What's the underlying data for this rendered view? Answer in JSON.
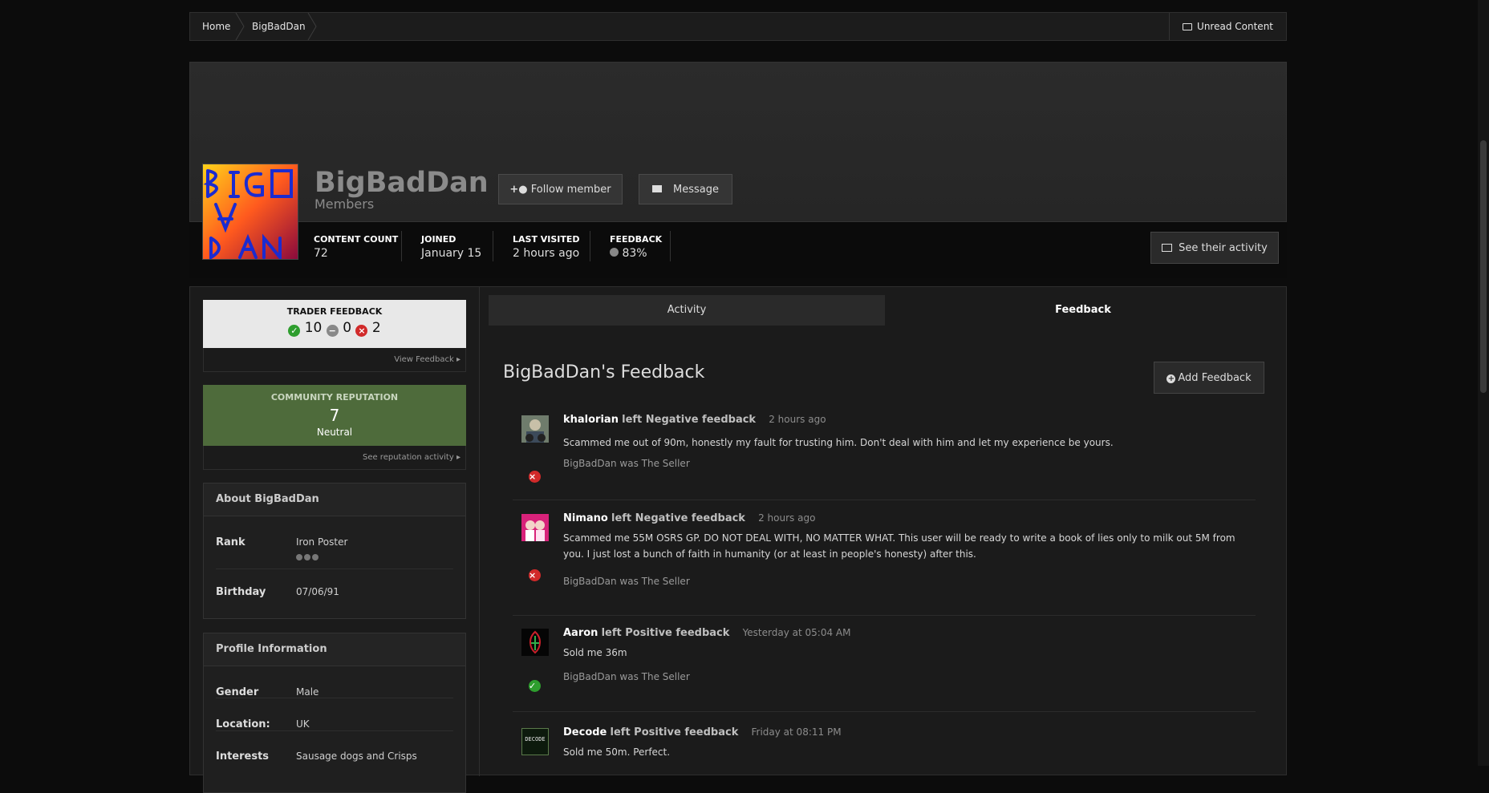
{
  "breadcrumb": {
    "home": "Home",
    "current": "BigBadDan",
    "unread": "Unread Content"
  },
  "profile": {
    "username": "BigBadDan",
    "group": "Members",
    "follow_label": "Follow member",
    "message_label": "Message",
    "see_activity_label": "See their activity",
    "stats": {
      "content_count_label": "CONTENT COUNT",
      "content_count": "72",
      "joined_label": "JOINED",
      "joined": "January 15",
      "last_visited_label": "LAST VISITED",
      "last_visited": "2 hours ago",
      "feedback_label": "FEEDBACK",
      "feedback": "83%"
    }
  },
  "sidebar": {
    "trader": {
      "title": "TRADER FEEDBACK",
      "positive": "10",
      "neutral": "0",
      "negative": "2",
      "view_link": "View Feedback"
    },
    "reputation": {
      "title": "COMMUNITY REPUTATION",
      "value": "7",
      "label": "Neutral",
      "link": "See reputation activity"
    },
    "about": {
      "title": "About BigBadDan",
      "rank_label": "Rank",
      "rank": "Iron Poster",
      "rank_pips": 3,
      "birthday_label": "Birthday",
      "birthday": "07/06/91"
    },
    "profile_info": {
      "title": "Profile Information",
      "gender_label": "Gender",
      "gender": "Male",
      "location_label": "Location:",
      "location": "UK",
      "interests_label": "Interests",
      "interests": "Sausage dogs and Crisps"
    }
  },
  "tabs": {
    "activity": "Activity",
    "feedback": "Feedback"
  },
  "feedback_section": {
    "title": "BigBadDan's Feedback",
    "add_label": "Add Feedback",
    "entries": [
      {
        "user": "khalorian",
        "action": "left Negative feedback",
        "time": "2 hours ago",
        "message": "Scammed me out of 90m, honestly my fault for trusting him. Don't deal with him and let my experience be yours.",
        "role": "BigBadDan was The Seller",
        "type": "negative"
      },
      {
        "user": "Nimano",
        "action": "left Negative feedback",
        "time": "2 hours ago",
        "message": "Scammed me 55M OSRS GP. DO NOT DEAL WITH, NO MATTER WHAT. This user will be ready to write a book of lies only to milk out 5M from you. I just lost a bunch of faith in humanity (or at least in people's honesty) after this.",
        "role": "BigBadDan was The Seller",
        "type": "negative"
      },
      {
        "user": "Aaron",
        "action": "left Positive feedback",
        "time": "Yesterday at 05:04 AM",
        "message": "Sold me 36m",
        "role": "BigBadDan was The Seller",
        "type": "positive"
      },
      {
        "user": "Decode",
        "action": "left Positive feedback",
        "time": "Friday at 08:11 PM",
        "message": "Sold me 50m. Perfect.",
        "role": "",
        "type": "positive",
        "avatar_text": "DECODE"
      }
    ]
  },
  "colors": {
    "positive": "#2e9e2e",
    "negative": "#d12a2a",
    "reputation_bg": "#4e6b3b"
  }
}
